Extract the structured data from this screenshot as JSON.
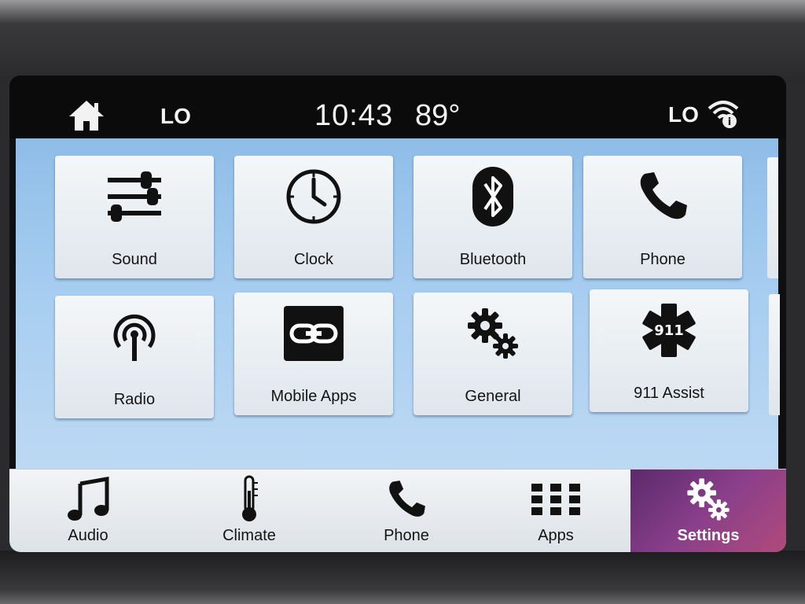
{
  "status_bar": {
    "left_indicator": "LO",
    "time": "10:43",
    "temperature": "89°",
    "right_indicator": "LO",
    "icons": [
      "home-icon",
      "wifi-info-icon"
    ]
  },
  "settings_tiles": [
    {
      "label": "Sound",
      "icon": "equalizer-sliders-icon"
    },
    {
      "label": "Clock",
      "icon": "clock-icon"
    },
    {
      "label": "Bluetooth",
      "icon": "bluetooth-icon"
    },
    {
      "label": "Phone",
      "icon": "phone-handset-icon"
    },
    {
      "label": "Radio",
      "icon": "radio-antenna-icon"
    },
    {
      "label": "Mobile Apps",
      "icon": "link-icon"
    },
    {
      "label": "General",
      "icon": "gears-icon"
    },
    {
      "label": "911 Assist",
      "icon": "star-of-life-911-icon"
    }
  ],
  "911_badge": "911",
  "pagination": {
    "pages": 2,
    "active_page": 1,
    "active_color": "#6a2a5e",
    "inactive_color": "#3e4a52"
  },
  "bottom_nav": [
    {
      "label": "Audio",
      "icon": "music-note-icon",
      "active": false
    },
    {
      "label": "Climate",
      "icon": "thermometer-icon",
      "active": false
    },
    {
      "label": "Phone",
      "icon": "phone-handset-icon",
      "active": false
    },
    {
      "label": "Apps",
      "icon": "apps-grid-icon",
      "active": false
    },
    {
      "label": "Settings",
      "icon": "gears-icon",
      "active": true
    }
  ],
  "colors": {
    "accent_active": "#8a3f8a",
    "content_background": "#a6cdf0",
    "status_bar_background": "#0b0b0c"
  }
}
